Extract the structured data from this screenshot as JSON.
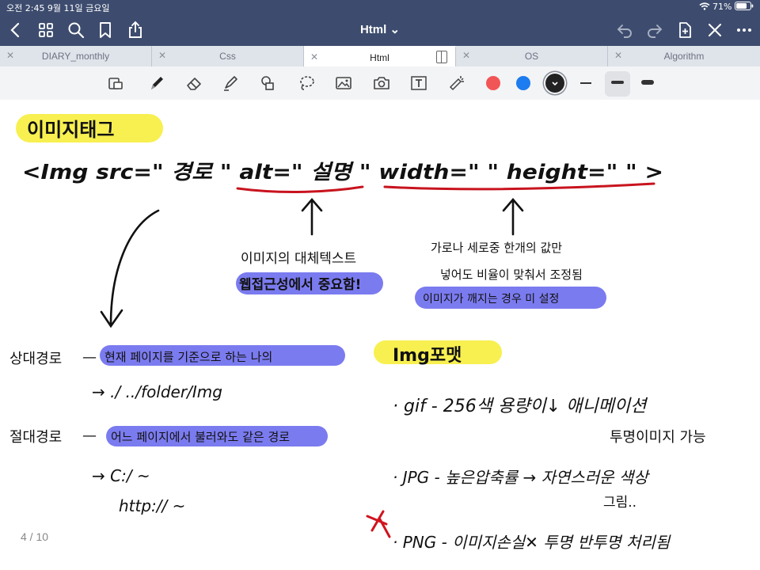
{
  "status_bar": {
    "time": "오전 2:45   9월 11일 금요일",
    "battery": "71%"
  },
  "nav": {
    "title": "Html ⌄"
  },
  "tabs": [
    {
      "label": "DIARY_monthly",
      "active": false
    },
    {
      "label": "Css",
      "active": false
    },
    {
      "label": "Html",
      "active": true
    },
    {
      "label": "OS",
      "active": false
    },
    {
      "label": "Algorithm",
      "active": false
    }
  ],
  "toolbar": {
    "colors": [
      "#f25555",
      "#1c7cf0",
      "#222222"
    ],
    "selected_color": "#222222"
  },
  "note": {
    "page": "4 / 10",
    "heading_1": "이미지태그",
    "tag_line": "<Img src=\" 경로 \" alt=\" 설명 \" width=\" \" height=\" \" >",
    "alt_note_1": "이미지의 대체텍스트",
    "alt_note_2": "웹접근성에서 중요함!",
    "size_note_1": "가로나 세로중 한개의 값만",
    "size_note_2": "넣어도 비율이 맞춰서 조정됨",
    "size_note_3": "이미지가 깨지는 경우 미 설정",
    "relative_label": "상대경로",
    "relative_desc": "현재 페이지를 기준으로 하는 나의",
    "relative_example": "→ ./  ../folder/Img",
    "absolute_label": "절대경로",
    "absolute_desc": "어느 페이지에서 불러와도 같은 경로",
    "absolute_example_1": "→ C:/ ~",
    "absolute_example_2": "http:// ~",
    "heading_2": "Img포맷",
    "gif_line": "· gif  - 256색 용량이↓ 애니메이션",
    "gif_line_2": "투명이미지 가능",
    "jpg_line": "· JPG - 높은압축률 → 자연스러운 색상",
    "jpg_line_2": "그림..",
    "png_line": "· PNG - 이미지손실✕ 투명 반투명 처리됨"
  }
}
